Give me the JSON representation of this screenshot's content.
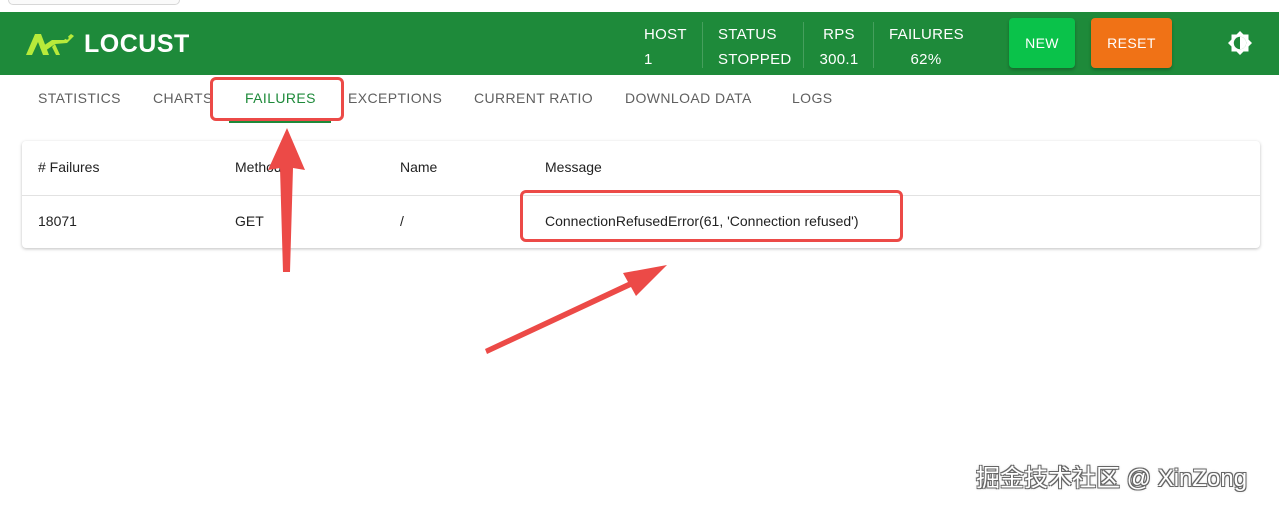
{
  "app": {
    "brand": "LOCUST",
    "colors": {
      "header_bg": "#1e8a3a",
      "new_button": "#0ac24a",
      "reset_button": "#f07216",
      "annotation": "#ec4a47"
    }
  },
  "header": {
    "stats": [
      {
        "label": "HOST",
        "value": "1"
      },
      {
        "label": "STATUS",
        "value": "STOPPED"
      },
      {
        "label": "RPS",
        "value": "300.1"
      },
      {
        "label": "FAILURES",
        "value": "62%"
      }
    ],
    "new_label": "NEW",
    "reset_label": "RESET",
    "theme_icon": "brightness-icon"
  },
  "tabs": [
    {
      "label": "STATISTICS",
      "active": false
    },
    {
      "label": "CHARTS",
      "active": false
    },
    {
      "label": "FAILURES",
      "active": true
    },
    {
      "label": "EXCEPTIONS",
      "active": false
    },
    {
      "label": "CURRENT RATIO",
      "active": false
    },
    {
      "label": "DOWNLOAD DATA",
      "active": false
    },
    {
      "label": "LOGS",
      "active": false
    }
  ],
  "failures_table": {
    "columns": [
      "# Failures",
      "Method",
      "Name",
      "Message"
    ],
    "rows": [
      [
        "18071",
        "GET",
        "/",
        "ConnectionRefusedError(61, 'Connection refused')"
      ]
    ]
  },
  "watermark": "掘金技术社区 @ XinZong"
}
